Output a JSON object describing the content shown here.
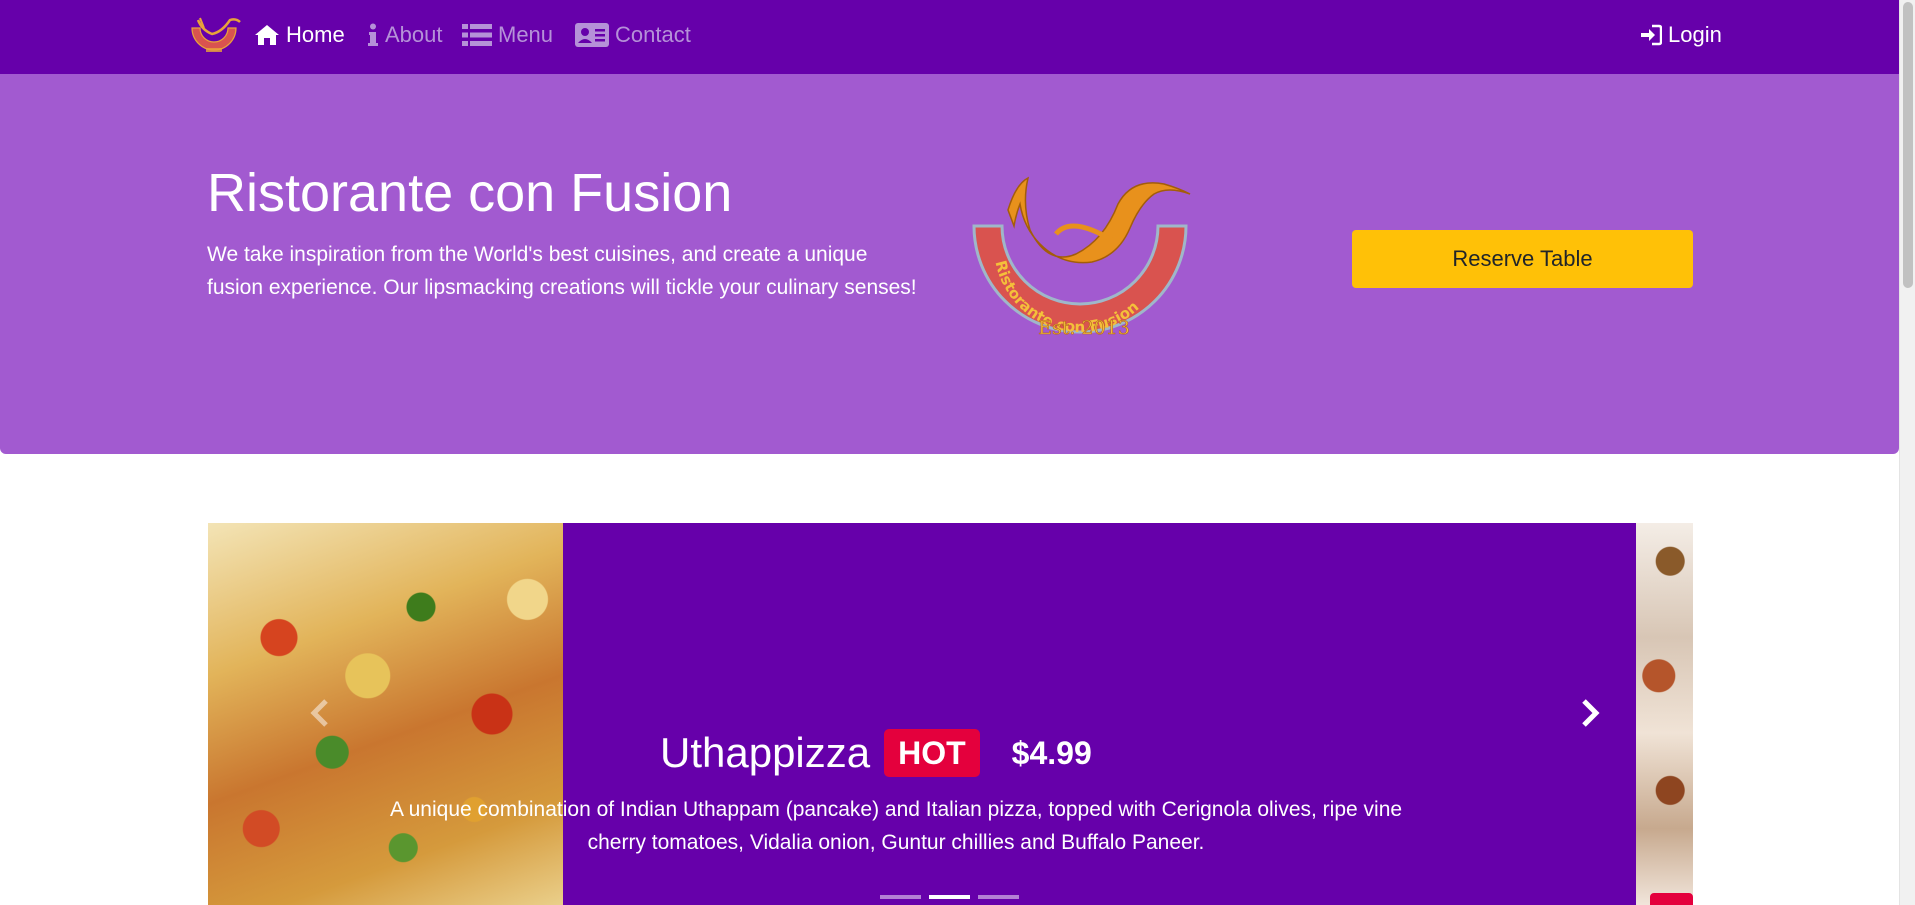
{
  "navbar": {
    "brand_icon": "restaurant-logo",
    "items": [
      {
        "label": "Home",
        "icon": "home-icon",
        "active": true
      },
      {
        "label": "About",
        "icon": "info-icon",
        "active": false
      },
      {
        "label": "Menu",
        "icon": "list-icon",
        "active": false
      },
      {
        "label": "Contact",
        "icon": "address-card-icon",
        "active": false
      }
    ],
    "login_label": "Login",
    "login_icon": "sign-in-icon",
    "colors": {
      "background": "#6600aa",
      "inactive_link": "#b591d8",
      "active_link": "#ffffff"
    }
  },
  "jumbotron": {
    "title": "Ristorante con Fusion",
    "text": "We take inspiration from the World's best cuisines, and create a unique fusion experience. Our lipsmacking creations will tickle your culinary senses!",
    "logo": {
      "arc_text": "Ristorante con Fusion",
      "est_text": "Est. 2013"
    },
    "reserve_label": "Reserve Table",
    "colors": {
      "background": "#a25ad0",
      "button": "#ffc107"
    }
  },
  "carousel": {
    "title": "Uthappizza",
    "badge": "HOT",
    "price": "$4.99",
    "description": "A unique combination of Indian Uthappam (pancake) and Italian pizza, topped with Cerignola olives, ripe vine cherry tomatoes, Vidalia onion, Guntur chillies and Buffalo Paneer.",
    "indicator_count": 3,
    "active_indicator": 2,
    "colors": {
      "background": "#6600aa",
      "badge": "#e4003d"
    }
  }
}
